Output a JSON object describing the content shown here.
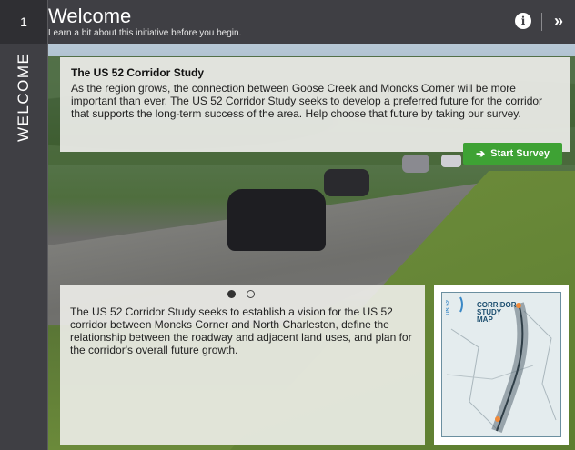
{
  "step": {
    "number": "1",
    "label": "WELCOME"
  },
  "header": {
    "title": "Welcome",
    "subtitle": "Learn a bit about this initiative before you begin.",
    "info_icon": "info-icon",
    "next_icon": "double-chevron-right-icon",
    "info_glyph": "i",
    "next_glyph": "»"
  },
  "intro_card": {
    "title": "The US 52 Corridor Study",
    "body": "As the region grows, the connection between Goose Creek and Moncks Corner will be more important than ever. The US 52 Corridor Study seeks to develop a preferred future for the corridor that supports the long-term success of the area. Help choose that future by taking our survey."
  },
  "start_survey": {
    "label": "Start Survey",
    "icon": "arrow-right-icon",
    "glyph": "➔",
    "color": "#3ea234"
  },
  "carousel": {
    "current": 1,
    "total": 2
  },
  "description_card": {
    "body": "The US 52 Corridor Study seeks to establish a vision for the US 52 corridor between Moncks Corner and North Charleston, define the relationship between the roadway and adjacent land uses, and plan for the corridor's overall future growth."
  },
  "map_thumbnail": {
    "title_line1": "CORRIDOR",
    "title_line2": "STUDY MAP",
    "side_label": "US 52"
  },
  "colors": {
    "chrome": "#3f3f44",
    "accent": "#3ea234"
  }
}
